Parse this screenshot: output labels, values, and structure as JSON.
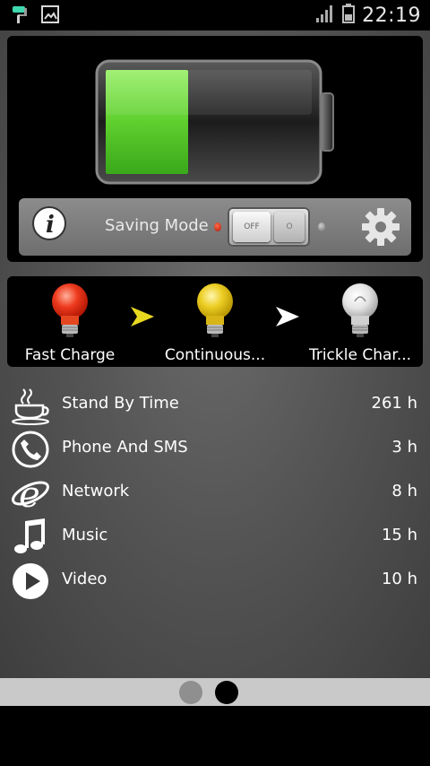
{
  "status_bar": {
    "time": "22:19",
    "icons": [
      "paint-roller-icon",
      "image-icon",
      "signal-icon",
      "battery-icon"
    ]
  },
  "battery": {
    "level_fraction": 0.4,
    "fill_color": "#6ed63a"
  },
  "saving": {
    "label": "Saving Mode",
    "toggle_off_text": "OFF",
    "toggle_on_text": "O",
    "state": "off"
  },
  "charge_stages": [
    {
      "label": "Fast Charge",
      "color": "#e8321c",
      "icon": "red-bulb-icon"
    },
    {
      "label": "Continuous...",
      "color": "#e6c91a",
      "icon": "yellow-bulb-icon"
    },
    {
      "label": "Trickle Char...",
      "color": "#d9d9d9",
      "icon": "white-bulb-icon"
    }
  ],
  "arrows": [
    {
      "color": "#e8d820",
      "icon": "yellow-arrow-icon"
    },
    {
      "color": "#ffffff",
      "icon": "white-arrow-icon"
    }
  ],
  "usage": [
    {
      "label": "Stand By Time",
      "value": "261 h",
      "icon": "coffee-cup-icon"
    },
    {
      "label": "Phone And SMS",
      "value": "3 h",
      "icon": "phone-icon"
    },
    {
      "label": "Network",
      "value": "8 h",
      "icon": "browser-e-icon"
    },
    {
      "label": "Music",
      "value": "15 h",
      "icon": "music-note-icon"
    },
    {
      "label": "Video",
      "value": "10 h",
      "icon": "play-icon"
    }
  ],
  "pager": {
    "pages": 2,
    "active": 2
  }
}
